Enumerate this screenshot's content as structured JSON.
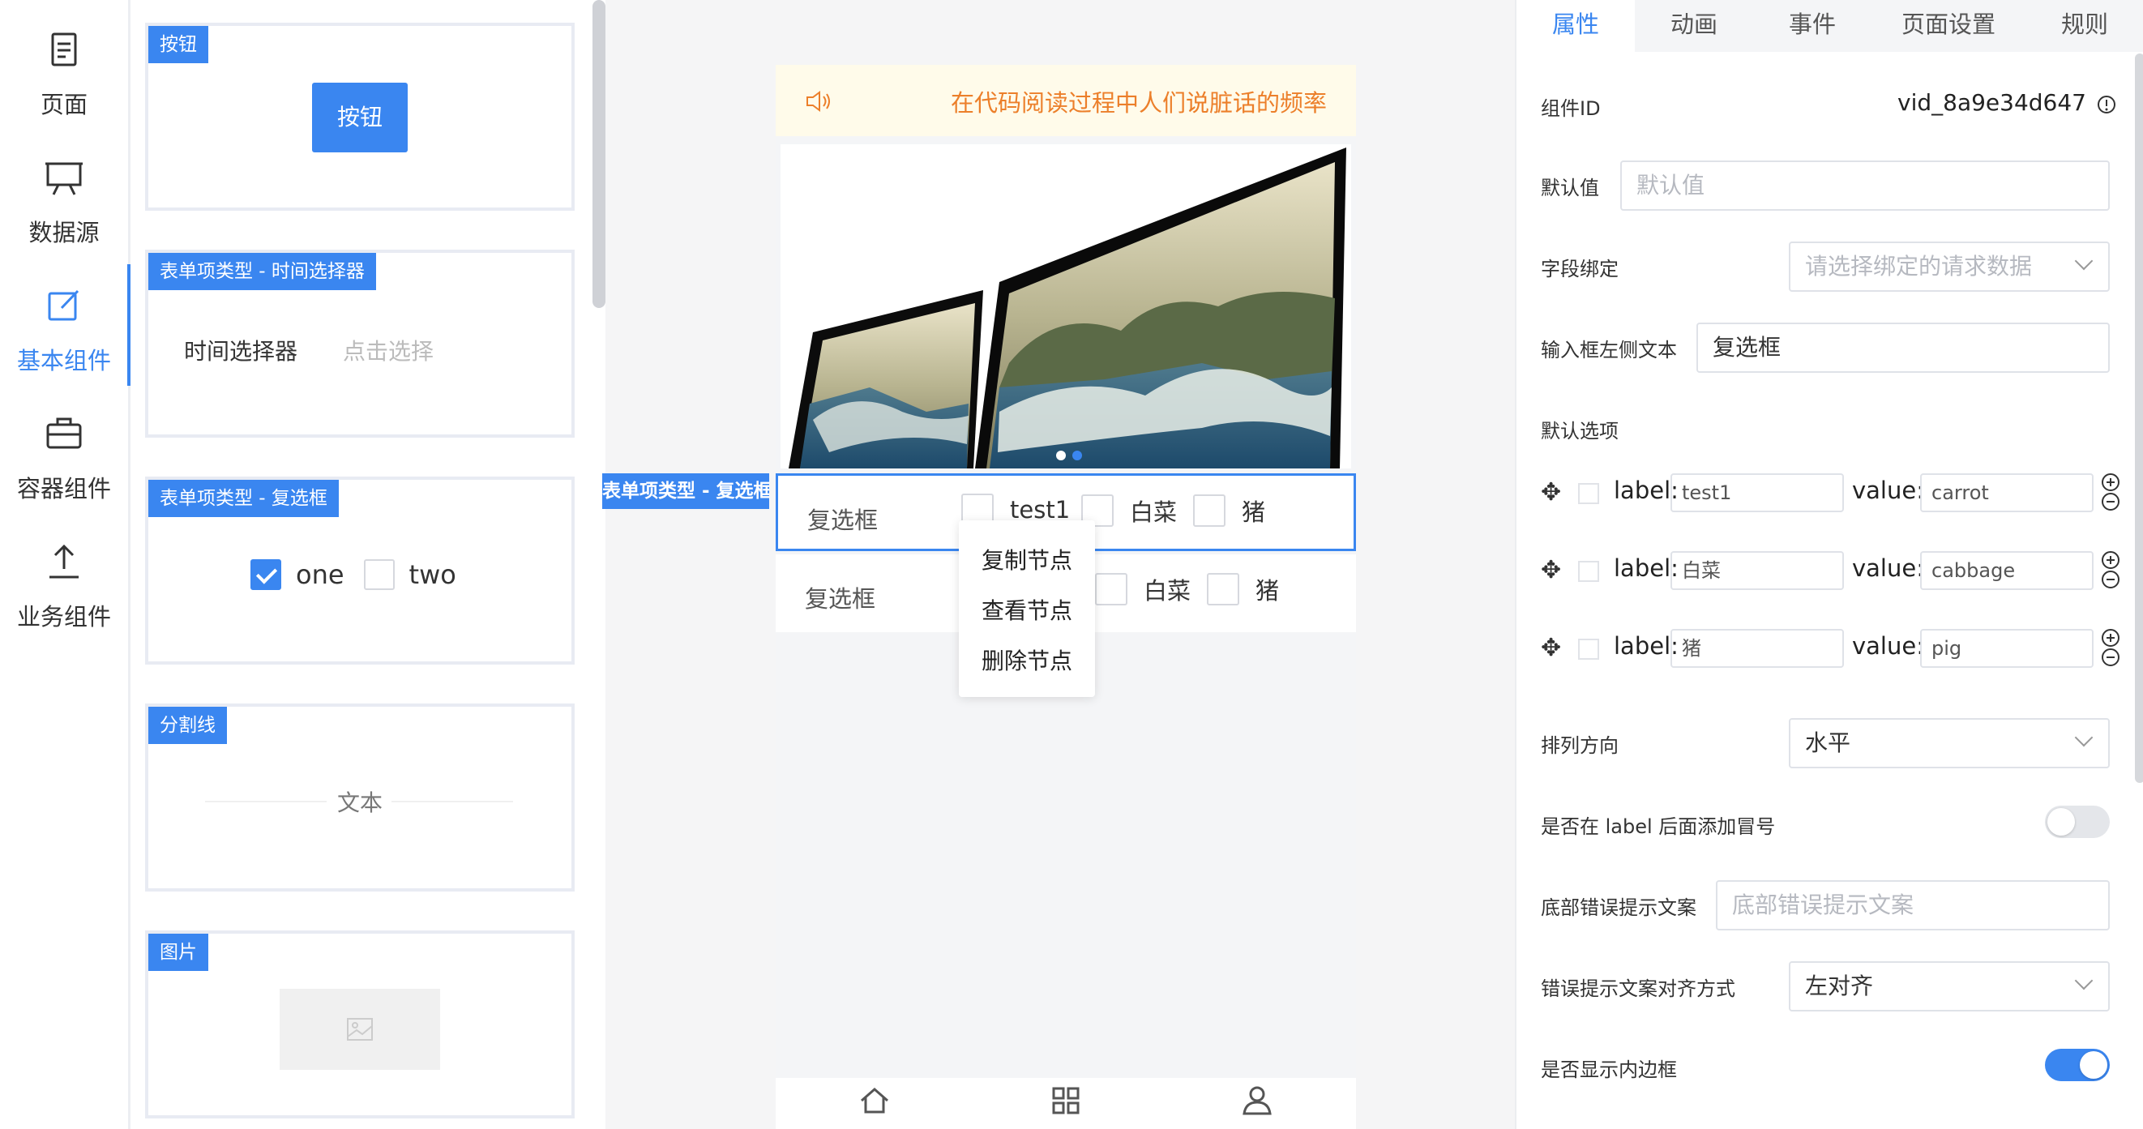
{
  "nav": {
    "items": [
      {
        "label": "页面",
        "icon": "document-icon"
      },
      {
        "label": "数据源",
        "icon": "presentation-icon"
      },
      {
        "label": "基本组件",
        "icon": "edit-icon",
        "active": true
      },
      {
        "label": "容器组件",
        "icon": "briefcase-icon"
      },
      {
        "label": "业务组件",
        "icon": "upload-icon"
      }
    ]
  },
  "palette": {
    "cards": [
      {
        "tag": "按钮",
        "button_label": "按钮"
      },
      {
        "tag": "表单项类型 - 时间选择器",
        "field_label": "时间选择器",
        "placeholder": "点击选择"
      },
      {
        "tag": "表单项类型 - 复选框",
        "options": [
          {
            "label": "one",
            "checked": true
          },
          {
            "label": "two",
            "checked": false
          }
        ]
      },
      {
        "tag": "分割线",
        "text": "文本"
      },
      {
        "tag": "图片"
      }
    ]
  },
  "canvas": {
    "notice": "在代码阅读过程中人们说脏话的频率",
    "selected_tag": "表单项类型 - 复选框",
    "rows": [
      {
        "label": "复选框",
        "options": [
          "test1",
          "白菜",
          "猪"
        ]
      },
      {
        "label": "复选框",
        "options": [
          "白菜",
          "猪"
        ]
      }
    ],
    "context_menu": [
      "复制节点",
      "查看节点",
      "删除节点"
    ],
    "tabbar": [
      "home-icon",
      "grid-icon",
      "user-icon"
    ]
  },
  "panel": {
    "tabs": [
      "属性",
      "动画",
      "事件",
      "页面设置",
      "规则"
    ],
    "component_id_label": "组件ID",
    "component_id_value": "vid_8a9e34d647",
    "default_value_label": "默认值",
    "default_value_placeholder": "默认值",
    "binding_label": "字段绑定",
    "binding_placeholder": "请选择绑定的请求数据",
    "left_text_label": "输入框左侧文本",
    "left_text_value": "复选框",
    "default_options_label": "默认选项",
    "options": [
      {
        "label_key": "label:",
        "label": "test1",
        "value_key": "value:",
        "value": "carrot"
      },
      {
        "label_key": "label:",
        "label": "白菜",
        "value_key": "value:",
        "value": "cabbage"
      },
      {
        "label_key": "label:",
        "label": "猪",
        "value_key": "value:",
        "value": "pig"
      }
    ],
    "direction_label": "排列方向",
    "direction_value": "水平",
    "colon_label": "是否在 label 后面添加冒号",
    "colon_on": false,
    "error_text_label": "底部错误提示文案",
    "error_text_placeholder": "底部错误提示文案",
    "error_align_label": "错误提示文案对齐方式",
    "error_align_value": "左对齐",
    "inner_border_label": "是否显示内边框",
    "inner_border_on": true
  },
  "colors": {
    "accent": "#3a86f0",
    "notice_text": "#ec7f2a",
    "notice_bg": "#fffbea"
  }
}
